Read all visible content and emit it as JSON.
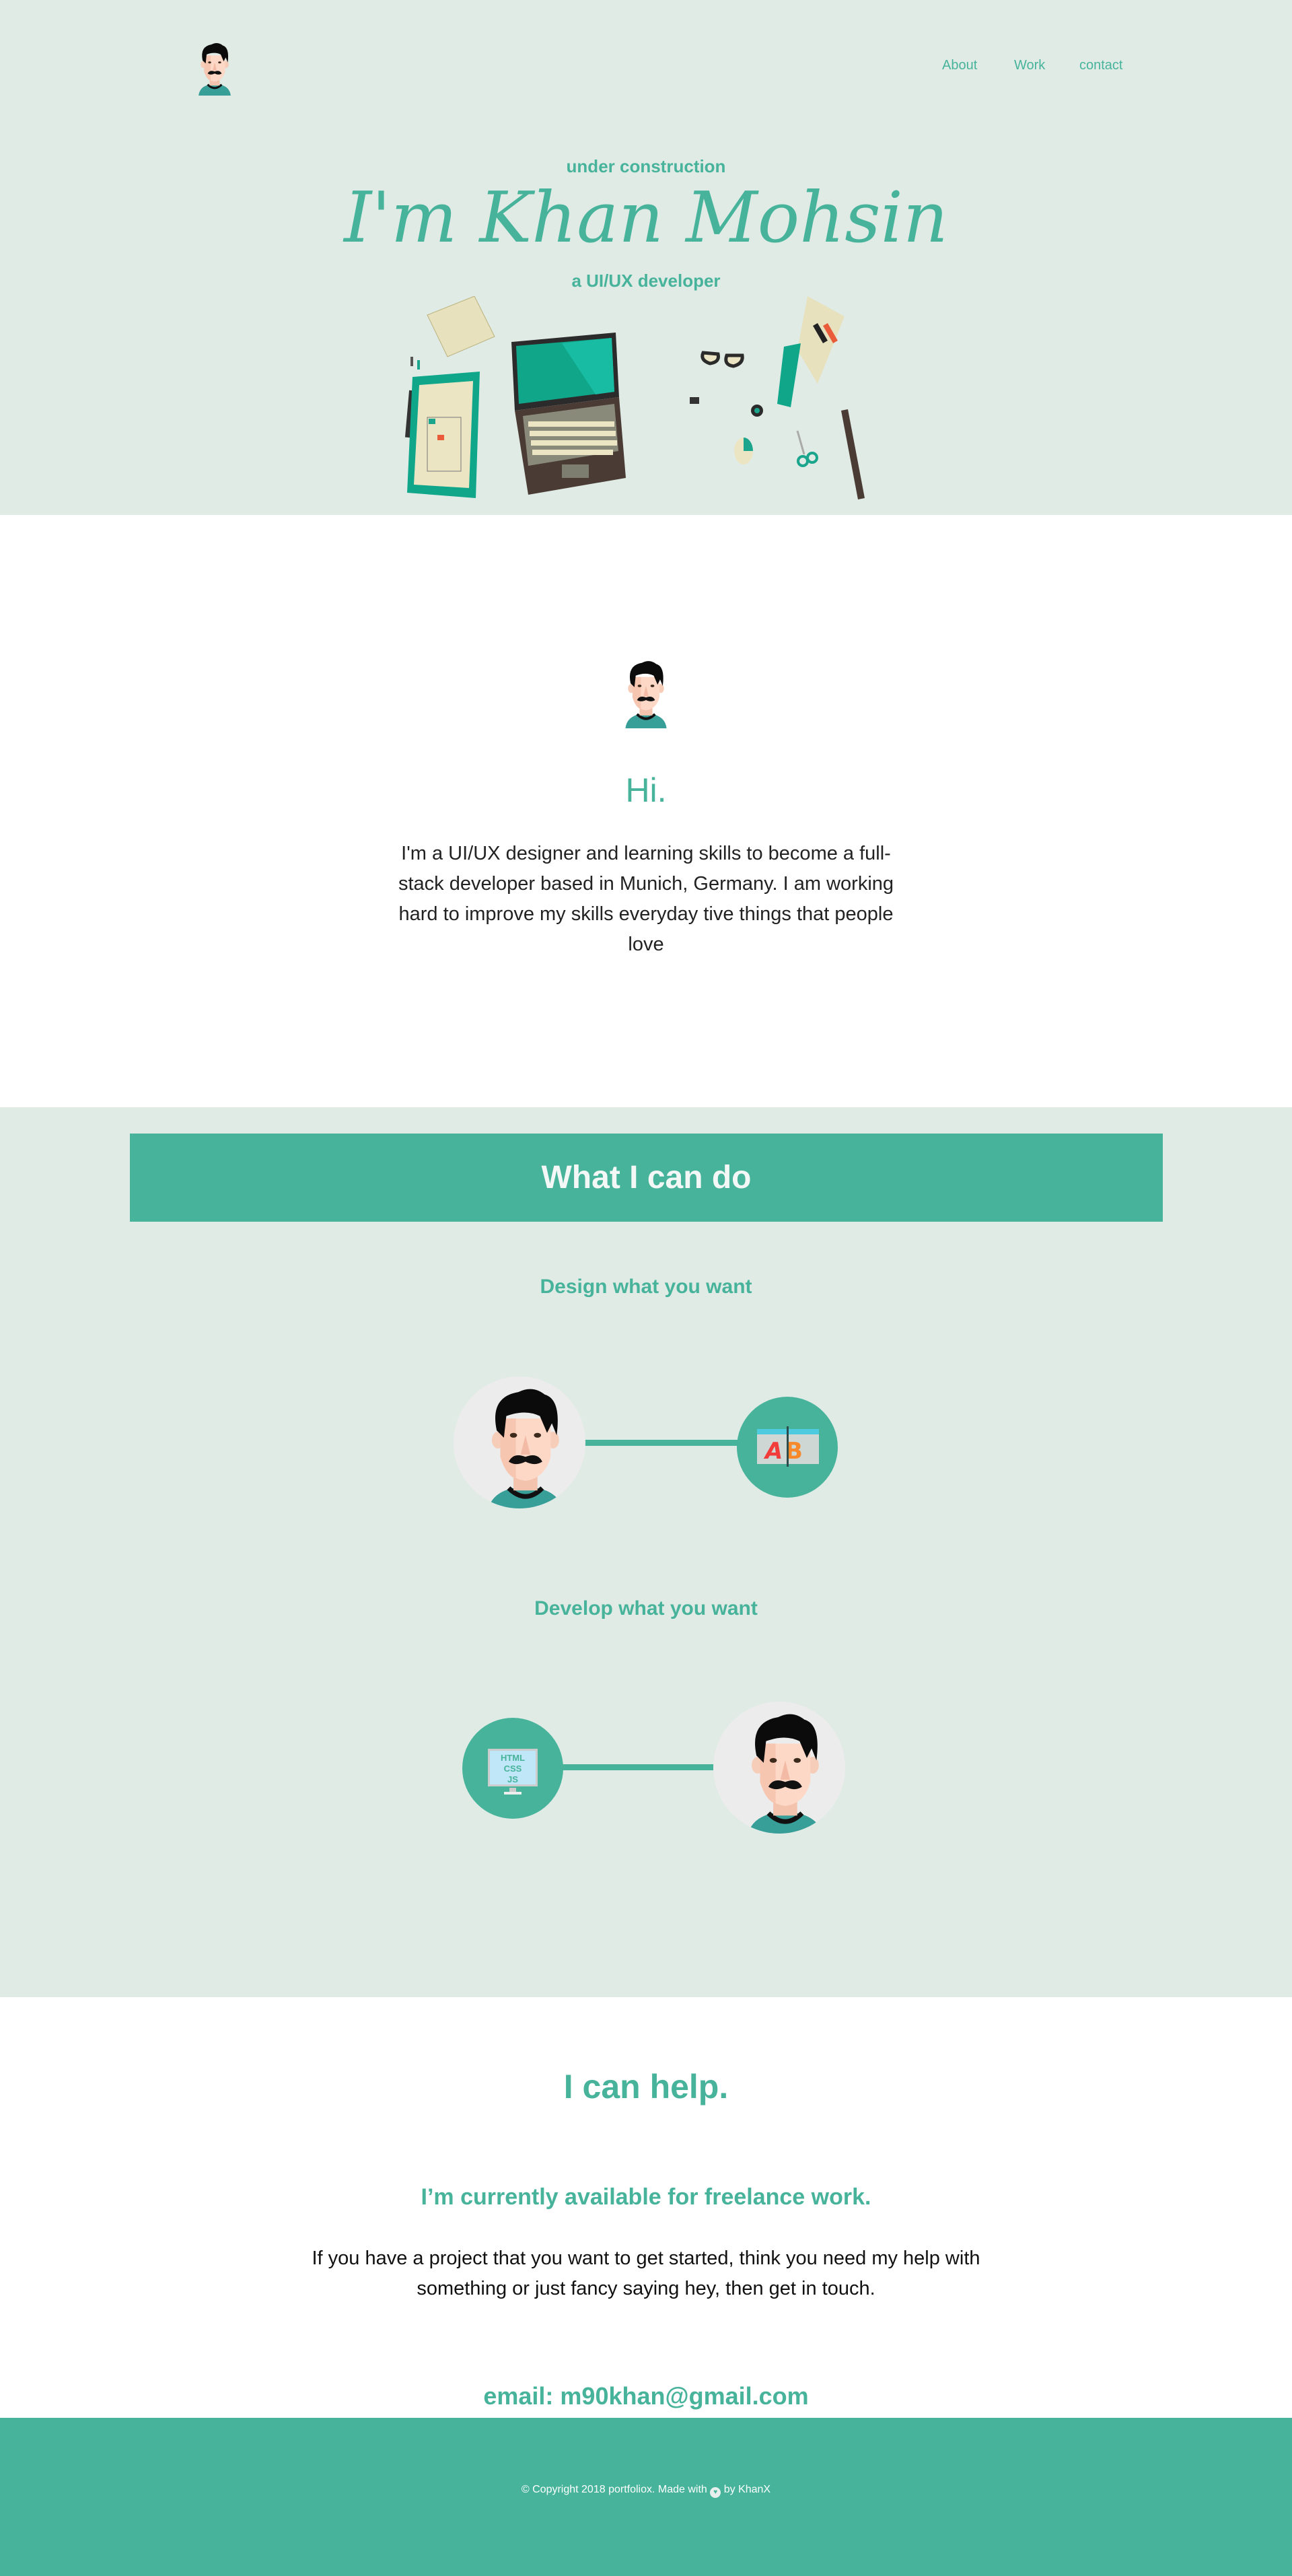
{
  "nav": {
    "about": "About",
    "work": "Work",
    "contact": "contact"
  },
  "hero": {
    "kicker": "under construction",
    "title": "I'm Khan Mohsin",
    "subtitle": "a UI/UX developer"
  },
  "about": {
    "heading": "Hi.",
    "text": "I'm a UI/UX designer and learning skills to become a full-stack developer based in Munich, Germany. I am working hard to improve my skills everyday tive things that people love"
  },
  "skills": {
    "banner": "What I can do",
    "design": "Design what you want",
    "develop": "Develop what you want",
    "code_icon_lines": [
      "HTML",
      "CSS",
      "JS"
    ]
  },
  "contact": {
    "heading": "I can help.",
    "subheading": "I’m currently available for freelance work.",
    "text": "If you have a project that you want to get started, think you need my help with something or just fancy saying hey, then get in touch.",
    "email": "email: m90khan@gmail.com"
  },
  "footer": {
    "before": "© Copyright 2018 portfoliox. Made with",
    "after": "by KhanX"
  },
  "colors": {
    "accent": "#47b39b",
    "bg": "#e0ebe6"
  }
}
